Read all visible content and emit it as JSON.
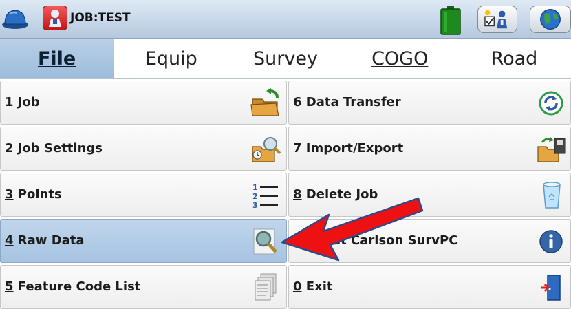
{
  "window": {
    "job_title": "JOB:TEST",
    "icons": [
      "hard-hat-icon",
      "app-logo-icon",
      "battery-icon",
      "settings-check-icon",
      "globe-icon"
    ]
  },
  "tabs": [
    {
      "label": "File",
      "active": true
    },
    {
      "label": "Equip",
      "active": false
    },
    {
      "label": "Survey",
      "active": false
    },
    {
      "label": "COGO",
      "active": false
    },
    {
      "label": "Road",
      "active": false
    }
  ],
  "menu": {
    "left": [
      {
        "num": "1",
        "text": " Job",
        "icon": "open-folder-icon"
      },
      {
        "num": "2",
        "text": " Job Settings",
        "icon": "folder-settings-icon"
      },
      {
        "num": "3",
        "text": " Points",
        "icon": "numbered-list-icon"
      },
      {
        "num": "4",
        "text": " Raw Data",
        "icon": "magnifier-icon",
        "selected": true
      },
      {
        "num": "5",
        "text": " Feature Code List",
        "icon": "stacked-pages-icon"
      }
    ],
    "right": [
      {
        "num": "6",
        "text": " Data Transfer",
        "icon": "sync-icon"
      },
      {
        "num": "7",
        "text": " Import/Export",
        "icon": "import-export-icon"
      },
      {
        "num": "8",
        "text": " Delete Job",
        "icon": "recycle-bin-icon"
      },
      {
        "num": "",
        "text": "out Carlson SurvPC",
        "icon": "info-icon"
      },
      {
        "num": "0",
        "text": " Exit",
        "icon": "exit-door-icon"
      }
    ]
  },
  "colors": {
    "accent_selected": "#a6c3e2",
    "arrow": "#ee1111",
    "titlebar": "#c7d7e9"
  }
}
